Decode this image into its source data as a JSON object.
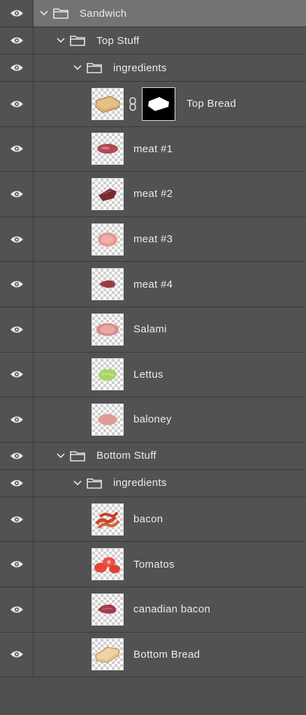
{
  "layers_panel": {
    "groups": {
      "sandwich": "Sandwich",
      "top_stuff": "Top Stuff",
      "top_ingredients": "ingredients",
      "bottom_stuff": "Bottom Stuff",
      "bottom_ingredients": "ingredients"
    },
    "layers": {
      "top_bread": "Top Bread",
      "meat1": "meat #1",
      "meat2": "meat #2",
      "meat3": "meat #3",
      "meat4": "meat #4",
      "salami": "Salami",
      "lettus": "Lettus",
      "baloney": "baloney",
      "bacon": "bacon",
      "tomatos": "Tomatos",
      "canadian_bacon": "canadian bacon",
      "bottom_bread": "Bottom Bread"
    },
    "colors": {
      "panel_bg": "#525252",
      "selected_bg": "#737373",
      "text": "#ececec"
    }
  }
}
